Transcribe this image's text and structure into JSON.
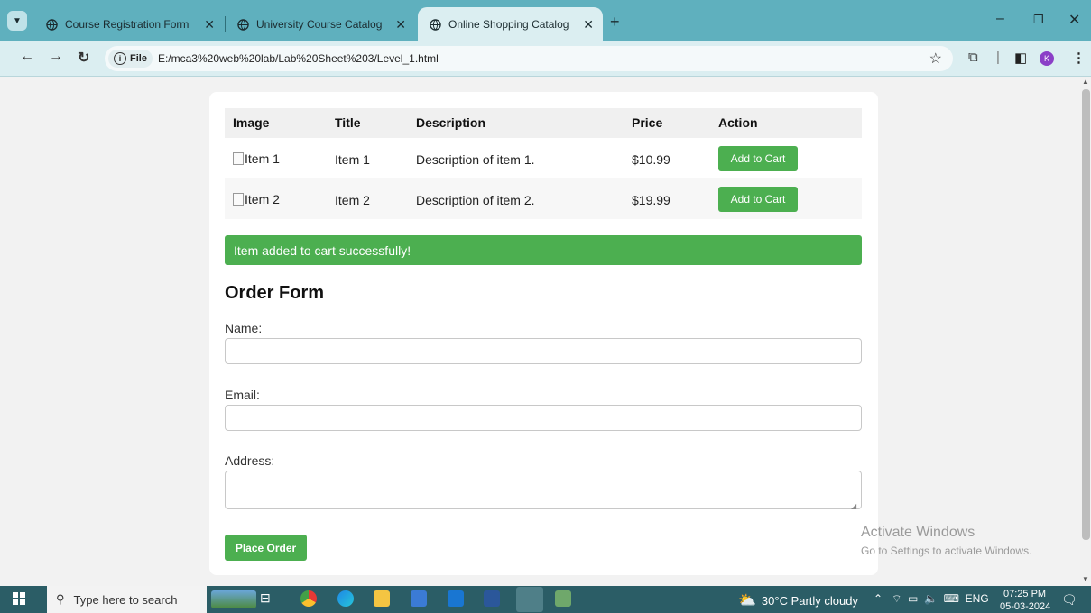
{
  "browser": {
    "tabs": [
      {
        "title": "Course Registration Form"
      },
      {
        "title": "University Course Catalog"
      },
      {
        "title": "Online Shopping Catalog"
      }
    ],
    "file_label": "File",
    "url": "E:/mca3%20web%20lab/Lab%20Sheet%203/Level_1.html",
    "profile_initial": "K"
  },
  "table": {
    "headers": [
      "Image",
      "Title",
      "Description",
      "Price",
      "Action"
    ],
    "rows": [
      {
        "image_alt": "Item 1",
        "title": "Item 1",
        "description": "Description of item 1.",
        "price": "$10.99",
        "action": "Add to Cart"
      },
      {
        "image_alt": "Item 2",
        "title": "Item 2",
        "description": "Description of item 2.",
        "price": "$19.99",
        "action": "Add to Cart"
      }
    ]
  },
  "message": "Item added to cart successfully!",
  "form": {
    "title": "Order Form",
    "name_label": "Name:",
    "email_label": "Email:",
    "address_label": "Address:",
    "submit_label": "Place Order"
  },
  "watermark": {
    "line1": "Activate Windows",
    "line2": "Go to Settings to activate Windows."
  },
  "taskbar": {
    "search_placeholder": "Type here to search",
    "weather": "30°C  Partly cloudy",
    "language": "ENG",
    "time": "07:25 PM",
    "date": "05-03-2024"
  },
  "colors": {
    "accent_green": "#4caf50",
    "tabbar": "#5fb0be",
    "taskbar": "#2b5d66"
  }
}
